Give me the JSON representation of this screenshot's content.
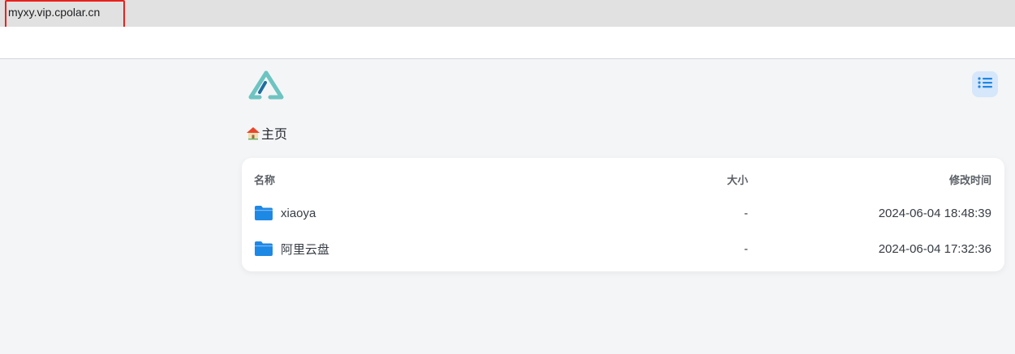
{
  "browser": {
    "url": "myxy.vip.cpolar.cn"
  },
  "header": {
    "logo_icon": "alist-logo-icon",
    "view_toggle_icon": "list-icon"
  },
  "breadcrumb": {
    "home_icon": "house-icon",
    "home_label": "主页"
  },
  "file_list": {
    "columns": {
      "name": "名称",
      "size": "大小",
      "modified": "修改时间"
    },
    "items": [
      {
        "name": "xiaoya",
        "size": "-",
        "modified": "2024-06-04 18:48:39",
        "icon": "folder-icon"
      },
      {
        "name": "阿里云盘",
        "size": "-",
        "modified": "2024-06-04 17:32:36",
        "icon": "folder-icon"
      }
    ]
  },
  "colors": {
    "accent": "#1e88e5",
    "folder": "#1e88e5",
    "logo": "#6dc4c1",
    "highlight": "#e8211d",
    "background": "#f4f5f7"
  }
}
